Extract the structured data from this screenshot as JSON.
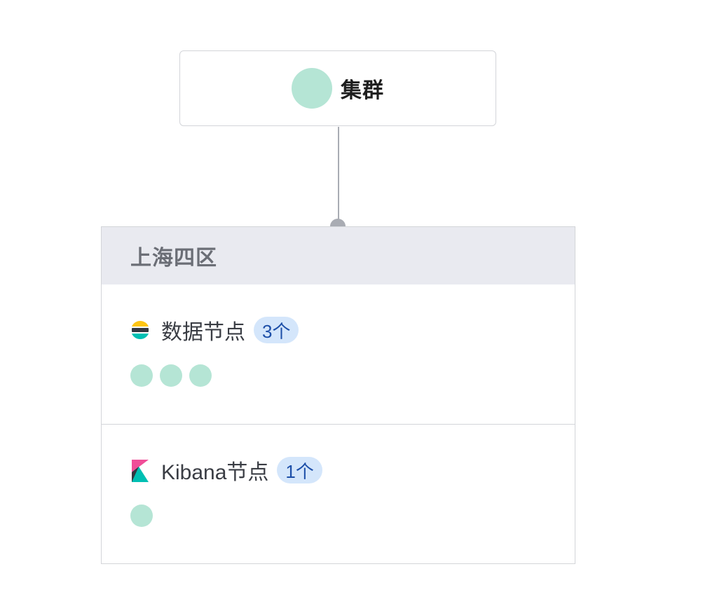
{
  "colors": {
    "instance_dot": "#b5e5d5",
    "badge_bg": "#d4e6fb",
    "badge_text": "#1d4fa8",
    "header_bg": "#e9eaf0",
    "border": "#d3d5d9",
    "connector": "#a9acb3"
  },
  "cluster": {
    "title": "集群",
    "icon": "status-dot"
  },
  "region": {
    "title": "上海四区",
    "node_groups": [
      {
        "label": "数据节点",
        "count_label": "3个",
        "icon": "elasticsearch-icon",
        "instances": 3
      },
      {
        "label": "Kibana节点",
        "count_label": "1个",
        "icon": "kibana-icon",
        "instances": 1
      }
    ]
  }
}
